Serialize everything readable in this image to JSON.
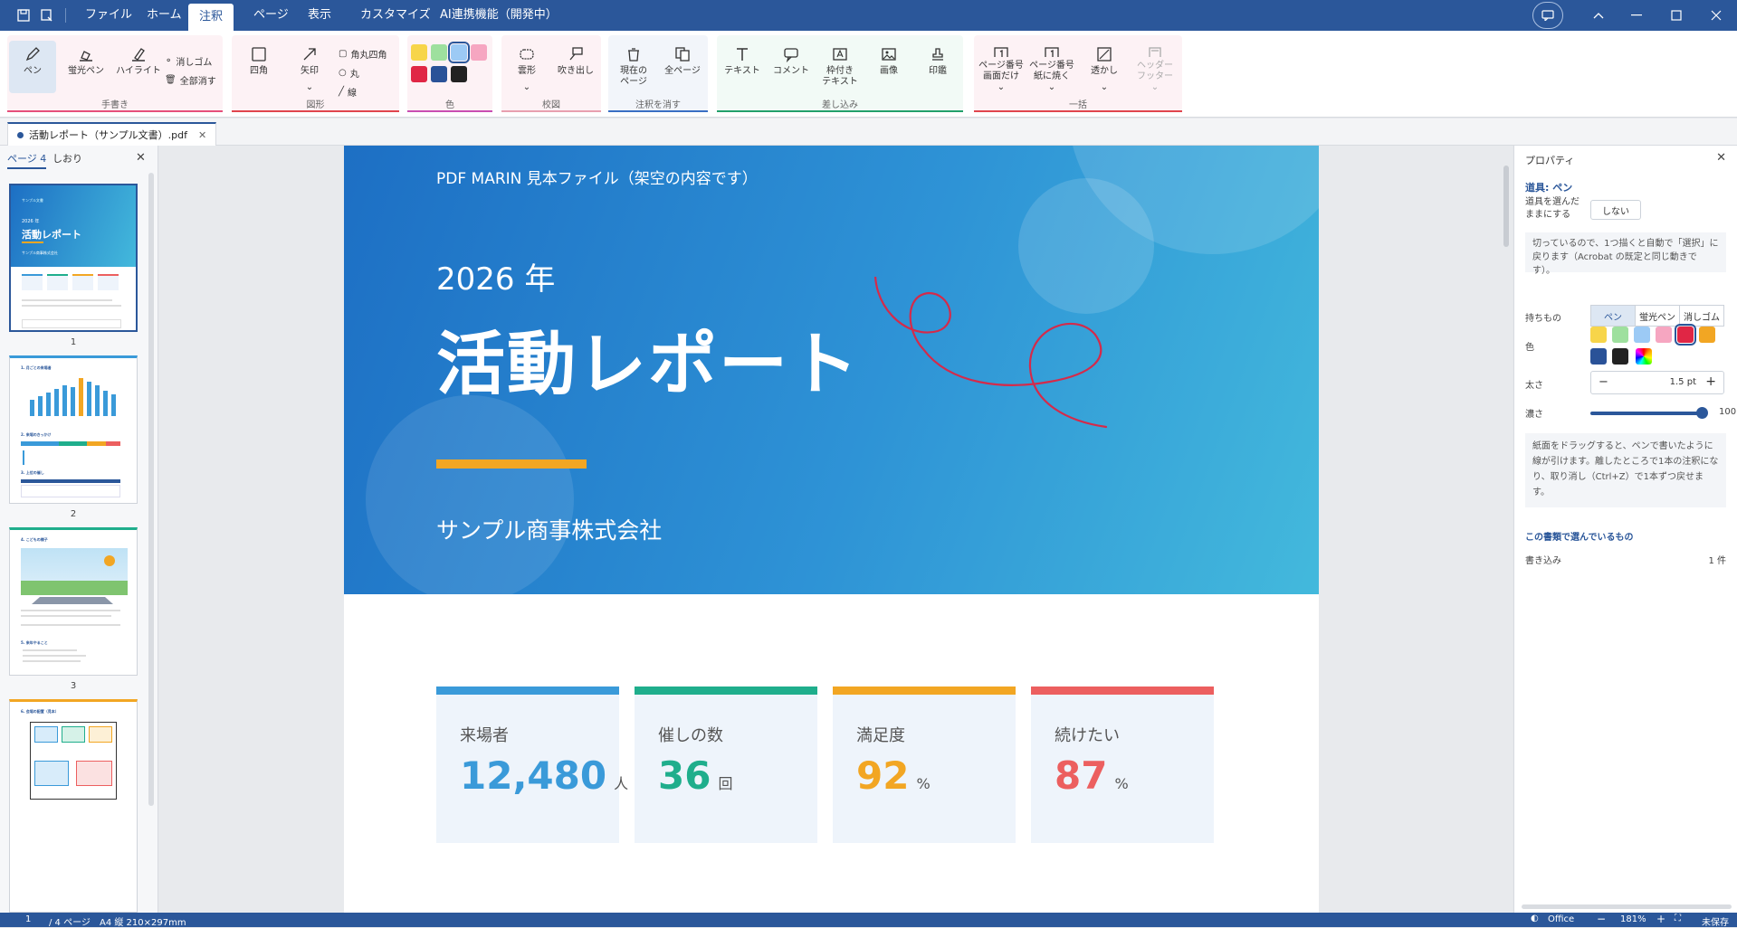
{
  "menu": {
    "items": [
      "ファイル",
      "ホーム",
      "注釈",
      "ページ",
      "表示",
      "カスタマイズ",
      "AI連携機能（開発中）"
    ],
    "active_index": 2
  },
  "ribbon": {
    "tegaki": {
      "pen": "ペン",
      "keikou": "蛍光ペン",
      "highlight": "ハイライト",
      "eraser": "消しゴム",
      "erase_all": "全部消す",
      "label": "手書き"
    },
    "zukei": {
      "rect": "四角",
      "arrow": "矢印",
      "rounded": "角丸四角",
      "circle": "丸",
      "line": "線",
      "label": "図形"
    },
    "iro": {
      "label": "色"
    },
    "kozu": {
      "cloud": "雲形",
      "callout": "吹き出し",
      "label": "校図"
    },
    "keshi": {
      "current_page": "現在の\nページ",
      "current_page_1": "現在の",
      "current_page_2": "ページ",
      "all_pages": "全ページ",
      "label": "注釈を消す"
    },
    "sashikomi": {
      "text": "テキスト",
      "comment": "コメント",
      "boxed_text_1": "枠付き",
      "boxed_text_2": "テキスト",
      "image": "画像",
      "stamp": "印鑑",
      "label": "差し込み"
    },
    "ikkatsu": {
      "pagenum_1": "ページ番号",
      "pagenum_1b": "画面だけ",
      "pagenum_2": "ページ番号",
      "pagenum_2b": "紙に焼く",
      "watermark": "透かし",
      "header_1": "ヘッダー",
      "header_2": "フッター",
      "label": "一括"
    }
  },
  "swatch_colors": [
    "#f7d54a",
    "#9ee09e",
    "#9ccaf5",
    "#f6a6c1",
    "#e02645",
    "#2a5298",
    "#222222"
  ],
  "doc_tab": {
    "title": "活動レポート（サンプル文書）.pdf"
  },
  "left_pane": {
    "tab_pages": "ページ 4",
    "tab_bookmarks": "しおり",
    "thumb_numbers": [
      "1",
      "2",
      "3"
    ]
  },
  "thumb1": {
    "small": "サンプル文書",
    "year": "2026 年",
    "title": "活動レポート",
    "company": "サンプル商事株式会社"
  },
  "thumb2": {
    "h1": "1. 月ごとの来場者",
    "h2": "2. 来場のきっかけ",
    "h3": "3. 上位の催し"
  },
  "thumb3": {
    "h1": "4. こどもの様子",
    "h2": "5. 来年やること"
  },
  "thumb4": {
    "h1": "6. 会場の配置（見本）"
  },
  "page": {
    "subtitle": "PDF MARIN 見本ファイル（架空の内容です）",
    "year": "2026 年",
    "title": "活動レポート",
    "company": "サンプル商事株式会社",
    "cards": [
      {
        "label": "来場者",
        "value": "12,480",
        "unit": "人",
        "color": "#3a9ad9"
      },
      {
        "label": "催しの数",
        "value": "36",
        "unit": "回",
        "color": "#1fae8c"
      },
      {
        "label": "満足度",
        "value": "92",
        "unit": "%",
        "color": "#f2a623"
      },
      {
        "label": "続けたい",
        "value": "87",
        "unit": "%",
        "color": "#ec5f5f"
      }
    ]
  },
  "properties": {
    "title": "プロパティ",
    "tool": "道具: ペン",
    "keep_label_1": "道具を選んだ",
    "keep_label_2": "ままにする",
    "keep_value": "しない",
    "info": "切っているので、1つ描くと自動で「選択」に戻ります（Acrobat の既定と同じ動きです）。",
    "mochimono": "持ちもの",
    "seg": [
      "ペン",
      "蛍光ペン",
      "消しゴム"
    ],
    "color_label": "色",
    "colors": [
      "#f7d54a",
      "#9ee09e",
      "#9ccaf5",
      "#f6a6c1",
      "#e02645",
      "#f2a623",
      "#2a5298",
      "#222222"
    ],
    "thickness_label": "太さ",
    "thickness": "1.5 pt",
    "opacity_label": "濃さ",
    "opacity": "100",
    "hint": "紙面をドラッグすると、ペンで書いたように線が引けます。離したところで1本の注釈になり、取り消し（Ctrl+Z）で1本ずつ戻せます。",
    "selection_title": "この書類で選んでいるもの",
    "selection_item": "書き込み",
    "selection_count": "1 件"
  },
  "status": {
    "page": "1",
    "pages": "/ 4 ページ",
    "size": "A4 縦 210×297mm",
    "theme": "Office",
    "zoom": "181%",
    "saved": "未保存"
  }
}
